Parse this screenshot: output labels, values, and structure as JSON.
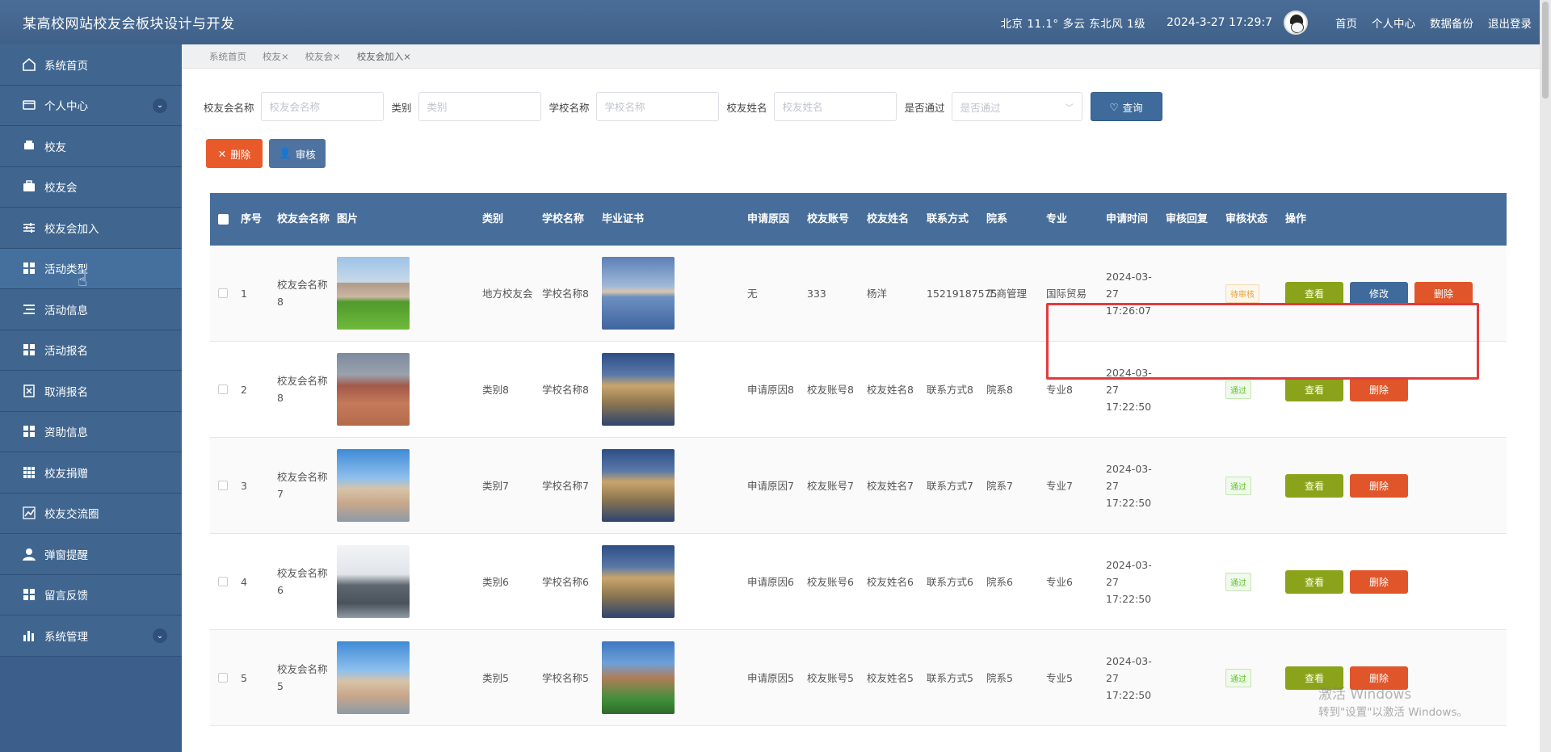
{
  "header": {
    "title": "某高校网站校友会板块设计与开发",
    "weather": "北京  11.1°  多云  东北风  1级",
    "clock": "2024-3-27 17:29:7",
    "links": [
      "首页",
      "个人中心",
      "数据备份",
      "退出登录"
    ]
  },
  "sidebar": {
    "items": [
      {
        "label": "系统首页",
        "icon": "home-icon"
      },
      {
        "label": "个人中心",
        "icon": "card-icon",
        "expandable": true
      },
      {
        "label": "校友",
        "icon": "print-icon"
      },
      {
        "label": "校友会",
        "icon": "briefcase-icon"
      },
      {
        "label": "校友会加入",
        "icon": "sliders-icon"
      },
      {
        "label": "活动类型",
        "icon": "grid-icon"
      },
      {
        "label": "活动信息",
        "icon": "list-icon"
      },
      {
        "label": "活动报名",
        "icon": "grid-icon"
      },
      {
        "label": "取消报名",
        "icon": "doc-x-icon"
      },
      {
        "label": "资助信息",
        "icon": "grid-icon"
      },
      {
        "label": "校友捐赠",
        "icon": "table-icon"
      },
      {
        "label": "校友交流圈",
        "icon": "chart-line-icon"
      },
      {
        "label": "弹窗提醒",
        "icon": "user-icon"
      },
      {
        "label": "留言反馈",
        "icon": "grid-icon"
      },
      {
        "label": "系统管理",
        "icon": "bar-chart-icon",
        "expandable": true
      }
    ]
  },
  "tabs": [
    "系统首页",
    "校友×",
    "校友会×",
    "校友会加入×"
  ],
  "search": {
    "fields": [
      {
        "label": "校友会名称",
        "placeholder": "校友会名称"
      },
      {
        "label": "类别",
        "placeholder": "类别"
      },
      {
        "label": "学校名称",
        "placeholder": "学校名称"
      },
      {
        "label": "校友姓名",
        "placeholder": "校友姓名"
      }
    ],
    "select_label": "是否通过",
    "select_placeholder": "是否通过",
    "query_label": "查询",
    "delete_label": "删除",
    "audit_label": "审核"
  },
  "table": {
    "headers": [
      "序号",
      "校友会名称",
      "图片",
      "类别",
      "学校名称",
      "毕业证书",
      "申请原因",
      "校友账号",
      "校友姓名",
      "联系方式",
      "院系",
      "专业",
      "申请时间",
      "审核回复",
      "审核状态",
      "操作"
    ],
    "buttons": {
      "view": "查看",
      "edit": "修改",
      "remove": "删除"
    },
    "rows": [
      {
        "index": "1",
        "name": "校友会名称8",
        "category": "地方校友会",
        "school": "学校名称8",
        "reason": "无",
        "account": "333",
        "alumni_name": "杨洋",
        "contact": "15219187575",
        "dept": "工商管理",
        "major": "国际贸易",
        "time": "2024-03-27 17:26:07",
        "reply": "",
        "status": "待审核",
        "status_type": "pending",
        "editable": true,
        "img_theme": "campus-green",
        "cert_theme": "bridge-lake"
      },
      {
        "index": "2",
        "name": "校友会名称8",
        "category": "类别8",
        "school": "学校名称8",
        "reason": "申请原因8",
        "account": "校友账号8",
        "alumni_name": "校友姓名8",
        "contact": "联系方式8",
        "dept": "院系8",
        "major": "专业8",
        "time": "2024-03-27 17:22:50",
        "reply": "",
        "status": "通过",
        "status_type": "pass",
        "editable": false,
        "img_theme": "plaza-brick",
        "cert_theme": "building-night"
      },
      {
        "index": "3",
        "name": "校友会名称7",
        "category": "类别7",
        "school": "学校名称7",
        "reason": "申请原因7",
        "account": "校友账号7",
        "alumni_name": "校友姓名7",
        "contact": "联系方式7",
        "dept": "院系7",
        "major": "专业7",
        "time": "2024-03-27 17:22:50",
        "reply": "",
        "status": "通过",
        "status_type": "pass",
        "editable": false,
        "img_theme": "building-sky",
        "cert_theme": "building-night"
      },
      {
        "index": "4",
        "name": "校友会名称6",
        "category": "类别6",
        "school": "学校名称6",
        "reason": "申请原因6",
        "account": "校友账号6",
        "alumni_name": "校友姓名6",
        "contact": "联系方式6",
        "dept": "院系6",
        "major": "专业6",
        "time": "2024-03-27 17:22:50",
        "reply": "",
        "status": "通过",
        "status_type": "pass",
        "editable": false,
        "img_theme": "modern-gray",
        "cert_theme": "building-night"
      },
      {
        "index": "5",
        "name": "校友会名称5",
        "category": "类别5",
        "school": "学校名称5",
        "reason": "申请原因5",
        "account": "校友账号5",
        "alumni_name": "校友姓名5",
        "contact": "联系方式5",
        "dept": "院系5",
        "major": "专业5",
        "time": "2024-03-27 17:22:50",
        "reply": "",
        "status": "通过",
        "status_type": "pass",
        "editable": false,
        "img_theme": "building-sky",
        "cert_theme": "campus-aerial"
      }
    ]
  },
  "watermark": {
    "line1": "激活 Windows",
    "line2": "转到\"设置\"以激活 Windows。"
  }
}
